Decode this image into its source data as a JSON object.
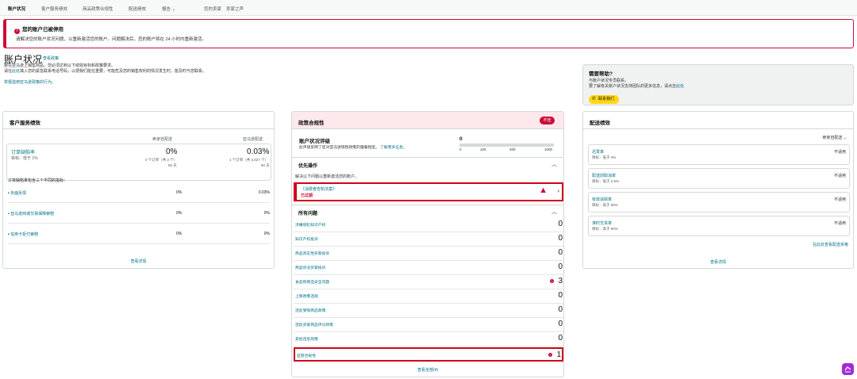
{
  "nav": {
    "tabs": [
      "账户状况",
      "客户服务绩效",
      "商品政策合规性",
      "配送绩效",
      "报告",
      "您的卖家",
      "卖家之声"
    ]
  },
  "banner": {
    "title": "您的账户已被停用",
    "desc": "请解决您的账户状况问题，以重新激活您的账户。问题解决后，您的账户将在 24 小时内重新激活。"
  },
  "header": {
    "title": "账户状况",
    "link": "查看政策",
    "line1": "要在亚马逊上销售商品，您必须达到以下绩效目标和政策要求。",
    "line2_prefix": "请在",
    "line2_link": "此处",
    "line2_suffix": "填入您的紧急联系电话号码，以便我们能在重要，可能危及您的销售权利的情况发生时，能及时与您联系。",
    "line3": "举报滥用亚马逊政策的行为。"
  },
  "help": {
    "title": "需要帮助?",
    "desc1": "与账户状况专员联系。",
    "desc2_prefix": "要了解有关账户状况支持团队的更多信息，请点击",
    "desc2_link": "此处",
    "button": "联系我们"
  },
  "customer_service": {
    "title": "客户服务绩效",
    "col1": "卖家自配送",
    "col2": "亚马逊配送",
    "odr": {
      "name": "订单缺陷率",
      "goal": "目标：低于 1%",
      "v1": "0%",
      "v1_sub": "0 个订单（共 2 个）",
      "v1_days": "60 天",
      "v2": "0.03%",
      "v2_sub": "1 个订单（共 3,027 个）",
      "v2_days": "60 天"
    },
    "intro": "订单缺陷率包含三个不同的指标：",
    "rows": [
      {
        "name": "负面反馈",
        "v1": "0%",
        "v2": "0.03%"
      },
      {
        "name": "亚马逊商城交易保障索赔",
        "v1": "0%",
        "v2": "0%"
      },
      {
        "name": "信用卡拒付索赔",
        "v1": "0%",
        "v2": "0%"
      }
    ],
    "footer": "查看详情"
  },
  "policy": {
    "title": "政策合规性",
    "badge": "不佳",
    "rating_title": "账户状况评级",
    "rating_desc": "此评级反映了您对亚马逊销售政策的遵循程度。",
    "rating_link": "了解更多信息。",
    "score": "0",
    "ticks": [
      "0",
      "100",
      "200",
      "1000"
    ],
    "priority_title": "优先操作",
    "priority_note": "解决以下问题以重新激活您的账户。",
    "priority_item": {
      "name": "《消费者告知法案》",
      "status": "已过期"
    },
    "all_title": "所有问题",
    "issues": [
      {
        "name": "涉嫌侵犯知识产权",
        "count": "0"
      },
      {
        "name": "知识产权投诉",
        "count": "0"
      },
      {
        "name": "商品真实性买家投诉",
        "count": "0"
      },
      {
        "name": "商品状况买家投诉",
        "count": "0"
      },
      {
        "name": "食品和商品安全问题",
        "count": "3"
      },
      {
        "name": "上架政策违规",
        "count": "0"
      },
      {
        "name": "违反受限商品政策",
        "count": "0"
      },
      {
        "name": "违反买家商品评论政策",
        "count": "0"
      },
      {
        "name": "其他违反政策",
        "count": "0"
      },
      {
        "name": "监管合规性",
        "count": "1"
      }
    ],
    "footer": "查看全部(4)"
  },
  "delivery": {
    "title": "配送绩效",
    "filter": "卖家自配送",
    "metrics": [
      {
        "name": "迟发率",
        "goal": "目标：低于 4%",
        "value": "不适用"
      },
      {
        "name": "配送前取消率",
        "goal": "目标：低于 2.5%",
        "value": "不适用"
      },
      {
        "name": "有效追踪率",
        "goal": "目标：高于 95%",
        "value": "不适用"
      },
      {
        "name": "准时交货率",
        "goal": "目标：高于 90%",
        "value": "不适用"
      }
    ],
    "more": "在此处查看配送资格",
    "footer": "查看详情"
  }
}
